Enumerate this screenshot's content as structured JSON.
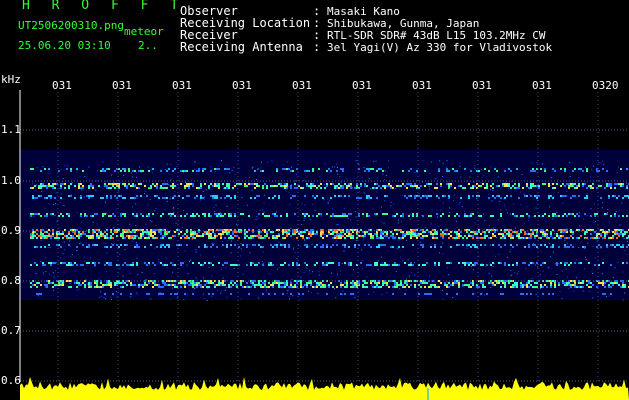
{
  "header": {
    "title": "H R O F F T",
    "file_name": "UT2506200310.png",
    "meteor_label": "meteor",
    "datetime": "25.06.20 03:10",
    "count": "2..",
    "fields": [
      {
        "label": "Observer",
        "value": "Masaki Kano"
      },
      {
        "label": "Receiving Location",
        "value": "Shibukawa, Gunma, Japan"
      },
      {
        "label": "Receiver",
        "value": "RTL-SDR SDR# 43dB L15 103.2MHz CW"
      },
      {
        "label": "Receiving Antenna",
        "value": "3el Yagi(V) Az 330 for Vladivostok"
      }
    ]
  },
  "x_axis": {
    "ticks": [
      "031",
      "031",
      "031",
      "031",
      "031",
      "031",
      "031",
      "031",
      "031",
      "0320"
    ]
  },
  "y_axis": {
    "unit": "kHz",
    "ticks": [
      "1.1",
      "1.0",
      "0.9",
      "0.8",
      "0.7",
      "0.6"
    ]
  },
  "colors": {
    "background": "#000000",
    "plot_background": "#00003a",
    "title_green": "#33ff33",
    "signal_trace": "#ffff00",
    "grid": "#ffffff"
  }
}
